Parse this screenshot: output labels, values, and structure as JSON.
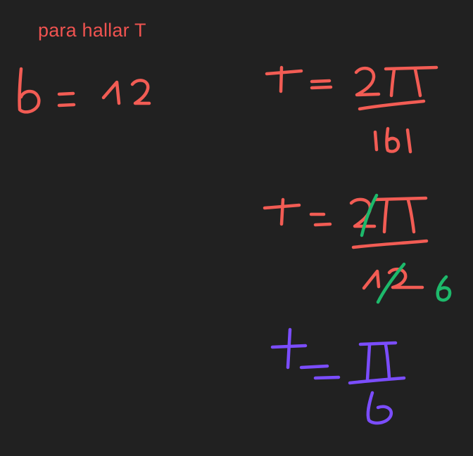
{
  "title": "para hallar T",
  "handwriting": {
    "given": "b = 12",
    "step_1": {
      "lhs": "T =",
      "numerator": "2π",
      "denominator": "|b|"
    },
    "step_2": {
      "lhs": "T =",
      "numerator": "2π",
      "denominator": "12",
      "simplified_denominator": "6"
    },
    "result": {
      "lhs": "T =",
      "numerator": "π",
      "denominator": "6"
    }
  },
  "colors": {
    "background": "#212121",
    "title_text": "#ef5350",
    "red_ink": "#f25c54",
    "green_ink": "#1db96b",
    "purple_ink": "#7b4dff"
  }
}
